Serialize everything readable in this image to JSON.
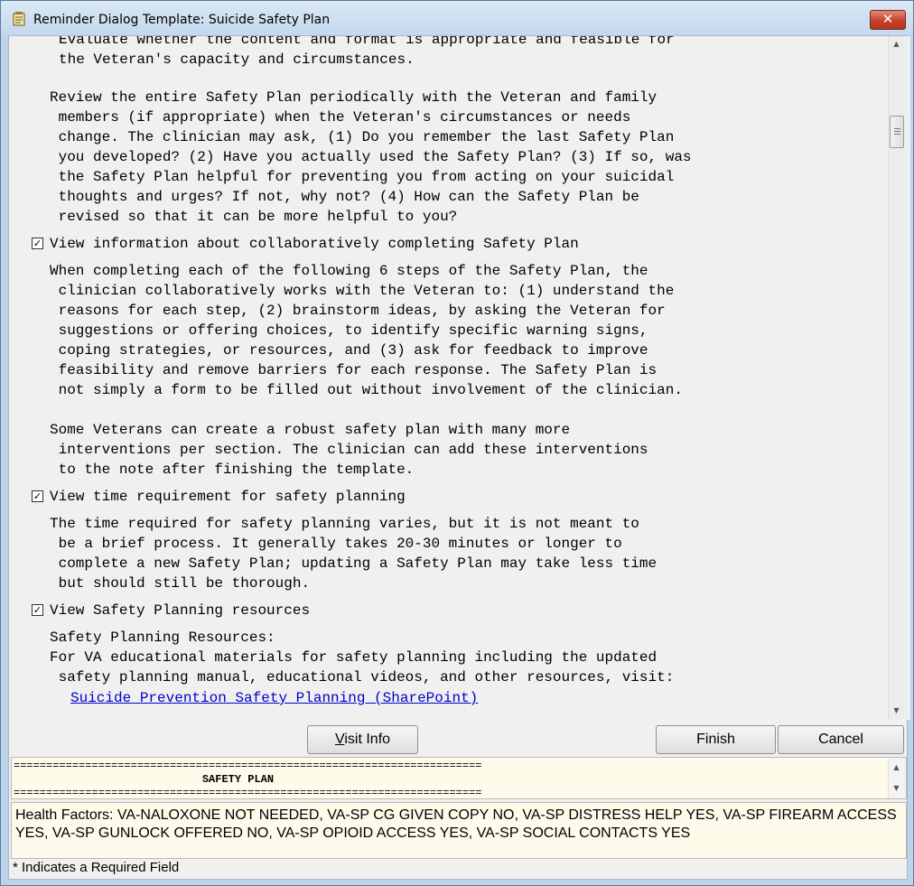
{
  "window": {
    "title": "Reminder Dialog Template: Suicide Safety Plan",
    "close_label": "✕"
  },
  "dialog": {
    "para_evaluate": [
      "Evaluate whether the content and format is appropriate and feasible for",
      "the Veteran's capacity and circumstances."
    ],
    "para_review": [
      "Review the entire Safety Plan periodically with the Veteran and family",
      " members (if appropriate) when the Veteran's circumstances or needs",
      " change. The clinician may ask, (1) Do you remember the last Safety Plan",
      " you developed? (2) Have you actually used the Safety Plan? (3) If so, was",
      " the Safety Plan helpful for preventing you from acting on your suicidal",
      " thoughts and urges? If not, why not? (4) How can the Safety Plan be",
      " revised so that it can be more helpful to you?"
    ],
    "checkbox_collab": {
      "label": "View information about collaboratively completing Safety Plan",
      "checked": true,
      "mark": "✓"
    },
    "para_collab": [
      "When completing each of the following 6 steps of the Safety Plan, the",
      " clinician collaboratively works with the Veteran to: (1) understand the",
      " reasons for each step, (2) brainstorm ideas, by asking the Veteran for",
      " suggestions or offering choices, to identify specific warning signs,",
      " coping strategies, or resources, and (3) ask for feedback to improve",
      " feasibility and remove barriers for each response. The Safety Plan is",
      " not simply a form to be filled out without involvement of the clinician."
    ],
    "para_robust": [
      "Some Veterans can create a robust safety plan with many more",
      " interventions per section. The clinician can add these interventions",
      " to the note after finishing the template."
    ],
    "checkbox_time": {
      "label": "View time requirement for safety planning",
      "checked": true,
      "mark": "✓"
    },
    "para_time": [
      "The time required for safety planning varies, but it is not meant to",
      " be a brief process. It generally takes 20-30 minutes or longer to",
      " complete a new Safety Plan; updating a Safety Plan may take less time",
      " but should still be thorough."
    ],
    "checkbox_resources": {
      "label": "View Safety Planning resources",
      "checked": true,
      "mark": "✓"
    },
    "para_resources": [
      "Safety Planning Resources:",
      "For VA educational materials for safety planning including the updated",
      " safety planning manual, educational videos, and other resources, visit:"
    ],
    "link_sharepoint": "Suicide Prevention Safety Planning (SharePoint)"
  },
  "buttons": {
    "visit_info_accel": "V",
    "visit_info_rest": "isit Info",
    "finish": "Finish",
    "cancel": "Cancel"
  },
  "note_preview": {
    "rule": "========================================================================",
    "heading": "                             SAFETY PLAN",
    "rule2": "========================================================================"
  },
  "health_factors": {
    "label": "Health Factors:",
    "value": " VA-NALOXONE NOT NEEDED, VA-SP CG GIVEN COPY NO, VA-SP DISTRESS HELP YES, VA-SP FIREARM ACCESS YES, VA-SP GUNLOCK OFFERED NO, VA-SP OPIOID ACCESS YES, VA-SP SOCIAL CONTACTS YES"
  },
  "footer": {
    "required_note": "* Indicates a Required Field"
  },
  "icons": {
    "title_icon": "notepad-icon",
    "scroll_up": "▲",
    "scroll_down": "▼"
  }
}
